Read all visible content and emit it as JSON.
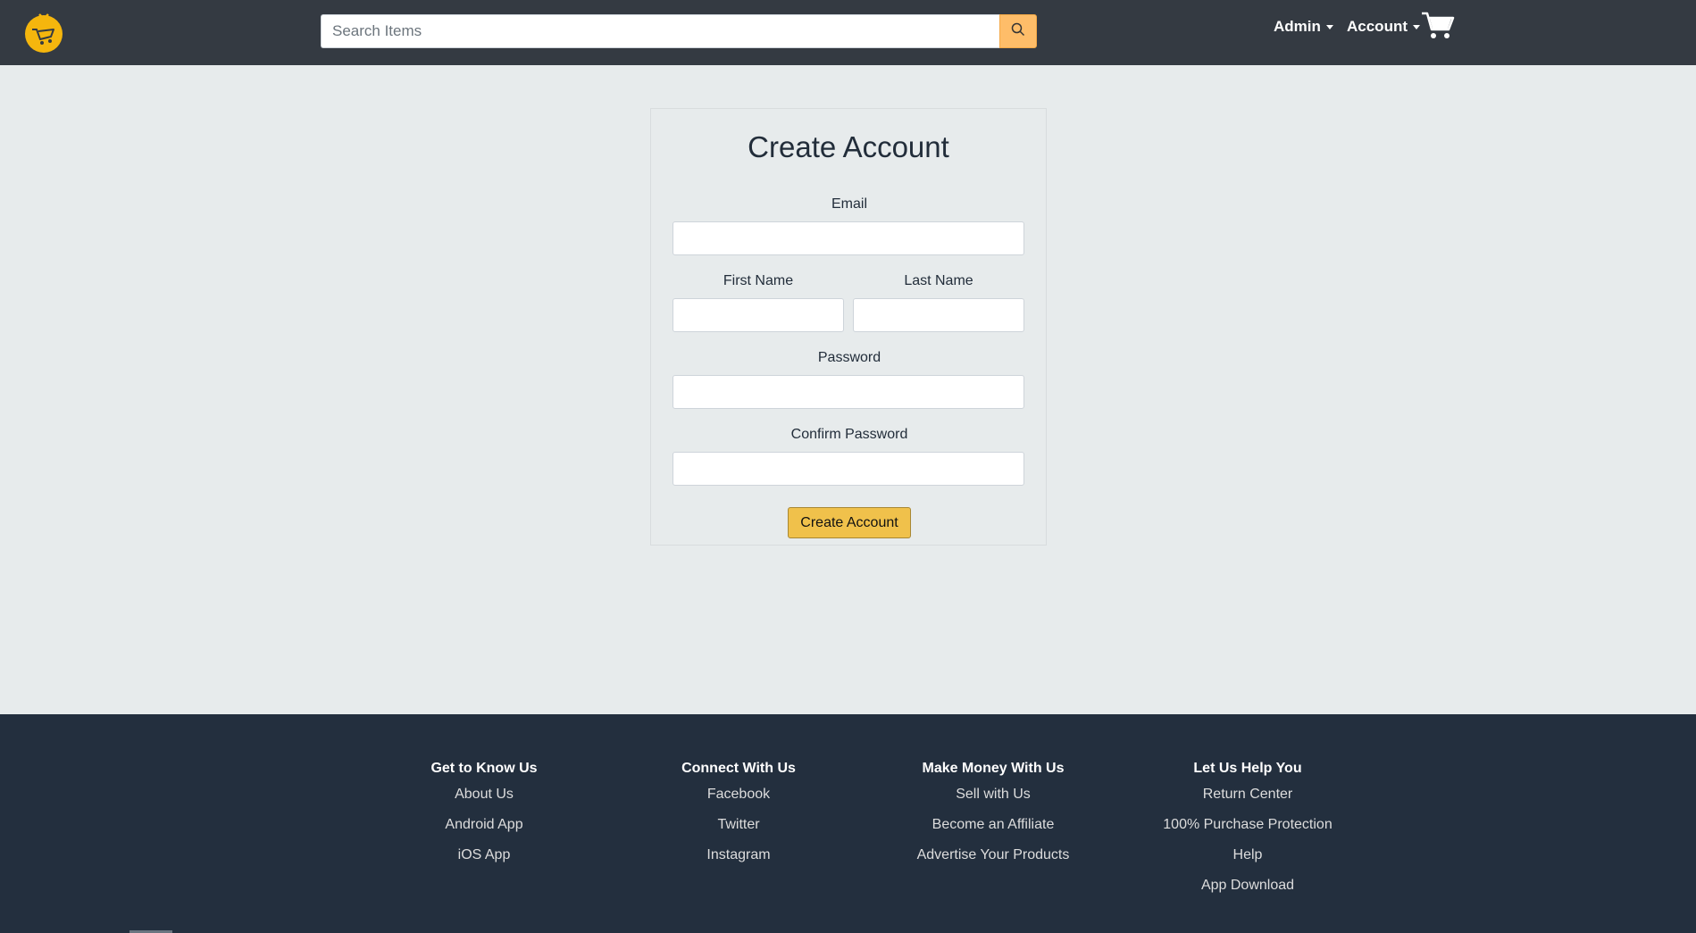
{
  "header": {
    "logo_icon": "shopping-cart-logo-icon",
    "search": {
      "placeholder": "Search Items",
      "value": "",
      "button_icon": "search-icon"
    },
    "nav": [
      {
        "label": "Admin",
        "icon": "caret-down-icon"
      },
      {
        "label": "Account",
        "icon": "caret-down-icon"
      }
    ],
    "cart_icon": "cart-icon"
  },
  "form": {
    "title": "Create Account",
    "fields": {
      "email": {
        "label": "Email",
        "value": ""
      },
      "first_name": {
        "label": "First Name",
        "value": ""
      },
      "last_name": {
        "label": "Last Name",
        "value": ""
      },
      "password": {
        "label": "Password",
        "value": ""
      },
      "confirm_password": {
        "label": "Confirm Password",
        "value": ""
      }
    },
    "submit_label": "Create Account"
  },
  "footer": {
    "columns": [
      {
        "heading": "Get to Know Us",
        "links": [
          "About Us",
          "Android App",
          "iOS App"
        ]
      },
      {
        "heading": "Connect With Us",
        "links": [
          "Facebook",
          "Twitter",
          "Instagram"
        ]
      },
      {
        "heading": "Make Money With Us",
        "links": [
          "Sell with Us",
          "Become an Affiliate",
          "Advertise Your Products"
        ]
      },
      {
        "heading": "Let Us Help You",
        "links": [
          "Return Center",
          "100% Purchase Protection",
          "Help",
          "App Download"
        ]
      }
    ]
  },
  "colors": {
    "header_bg": "#343a42",
    "page_bg": "#e7ebec",
    "footer_bg": "#232f3e",
    "accent": "#f0c14b",
    "search_button": "#febd69"
  }
}
